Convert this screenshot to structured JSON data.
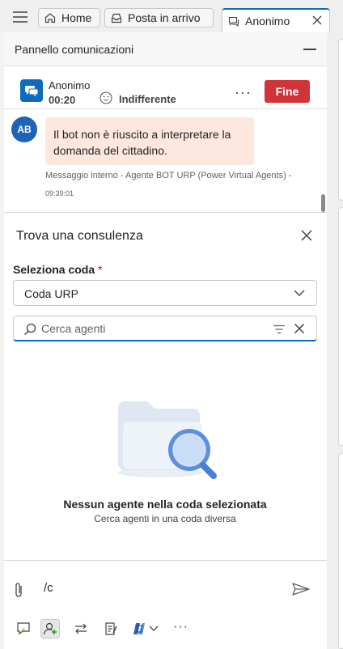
{
  "tabs": [
    {
      "label": "Home"
    },
    {
      "label": "Posta in arrivo"
    },
    {
      "label": "Anonimo"
    }
  ],
  "panel": {
    "title": "Pannello comunicazioni"
  },
  "conversation": {
    "customer": "Anonimo",
    "timer": "00:20",
    "sentiment": "Indifferente",
    "more": "···",
    "end_label": "Fine"
  },
  "message": {
    "initials": "AB",
    "text": "Il bot non è riuscito a interpretare la domanda del cittadino.",
    "meta": "Messaggio interno - Agente BOT URP (Power Virtual Agents) -",
    "time": "09:39:01"
  },
  "consult": {
    "title": "Trova una consulenza",
    "queue_label": "Seleziona coda",
    "required_mark": "*",
    "queue_value": "Coda URP",
    "search_placeholder": "Cerca agenti",
    "empty_title": "Nessun agente nella coda selezionata",
    "empty_subtitle": "Cerca agenti in una coda diversa"
  },
  "compose": {
    "text": "/c"
  },
  "toolbar": {
    "more": "···"
  },
  "colors": {
    "accent": "#0f6cbd",
    "end_button": "#d13438",
    "bubble": "#fde7de",
    "avatar": "#1e63b5"
  }
}
